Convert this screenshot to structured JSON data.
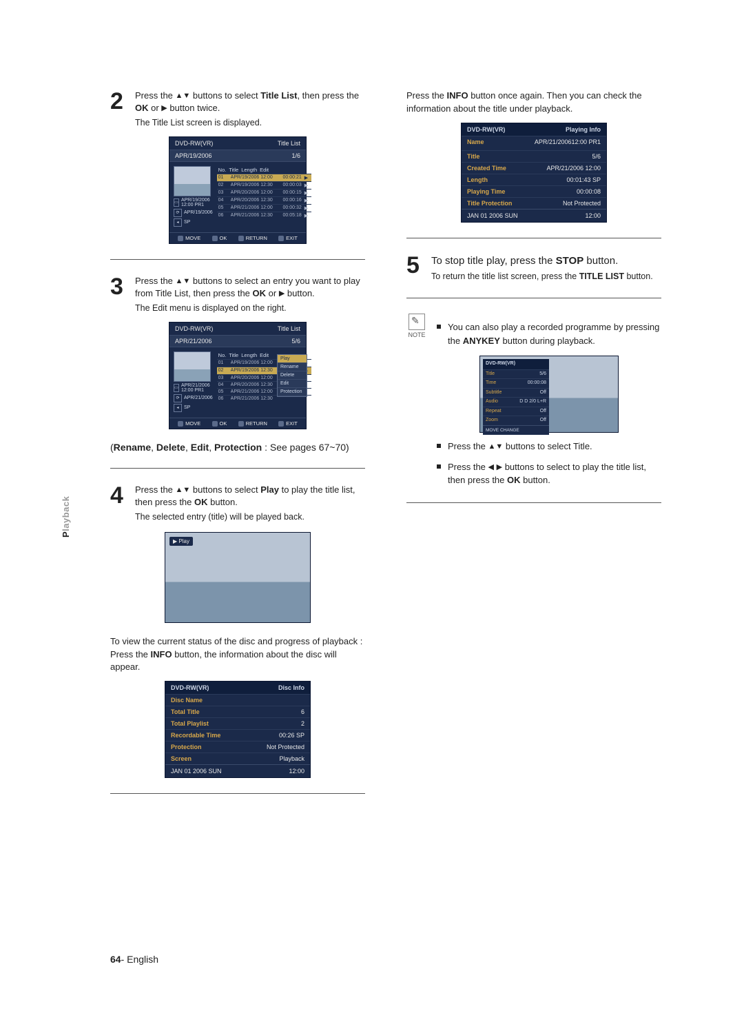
{
  "sideTab": {
    "bold": "P",
    "rest": "layback"
  },
  "pageNumber": "64",
  "pageLang": "English",
  "left": {
    "step2": {
      "num": "2",
      "l1_a": "Press the ",
      "l1_b": " buttons to select ",
      "l1_c": "Title List",
      "l1_d": ", then press the ",
      "l1_e": "OK",
      "l1_f": " or ",
      "l1_g": " button twice.",
      "sub": "The Title List screen is displayed."
    },
    "osd1": {
      "disc": "DVD-RW(VR)",
      "title": "Title List",
      "subA": "APR/19/2006",
      "subB": "1/6",
      "hdr": [
        "No.",
        "Title",
        "Length",
        "Edit"
      ],
      "rows": [
        {
          "n": "01",
          "t": "APR/19/2006 12:00",
          "l": "00:00:21",
          "sel": true
        },
        {
          "n": "02",
          "t": "APR/19/2006 12:30",
          "l": "00:00:03"
        },
        {
          "n": "03",
          "t": "APR/20/2006 12:00",
          "l": "00:00:15"
        },
        {
          "n": "04",
          "t": "APR/20/2006 12:30",
          "l": "00:00:16"
        },
        {
          "n": "05",
          "t": "APR/21/2006 12:00",
          "l": "00:00:32"
        },
        {
          "n": "06",
          "t": "APR/21/2006 12:30",
          "l": "00:05:18"
        }
      ],
      "side": {
        "a": "APR/19/2006 12:00 PR1",
        "b": "APR/19/2006",
        "c": "SP"
      },
      "ftr": [
        "MOVE",
        "OK",
        "RETURN",
        "EXIT"
      ]
    },
    "step3": {
      "num": "3",
      "l1_a": "Press the ",
      "l1_b": " buttons to select an entry you want to play from Title List, then press the ",
      "l1_c": "OK",
      "l1_d": " or ",
      "l1_e": " button.",
      "sub": "The Edit menu is displayed on the right."
    },
    "osd2": {
      "disc": "DVD-RW(VR)",
      "title": "Title List",
      "subA": "APR/21/2006",
      "subB": "5/6",
      "side": {
        "a": "APR/21/2006 12:00 PR1",
        "b": "APR/21/2006",
        "c": "SP"
      },
      "ctx": [
        "Play",
        "Rename",
        "Delete",
        "Edit",
        "Protection"
      ],
      "ftr": [
        "MOVE",
        "OK",
        "RETURN",
        "EXIT"
      ]
    },
    "paren": "(Rename, Delete, Edit, Protection : See pages 67~70)",
    "step4": {
      "num": "4",
      "l1_a": "Press the ",
      "l1_b": " buttons to select ",
      "l1_c": "Play",
      "l1_d": " to play the title list, then press the ",
      "l1_e": "OK",
      "l1_f": " button.",
      "sub": "The selected entry (title) will be played back."
    },
    "playLabel": "▶ Play",
    "viewInfo_a": "To view the current status of the disc and progress of playback : Press the ",
    "viewInfo_b": "INFO",
    "viewInfo_c": " button, the information about the disc will appear.",
    "discInfo": {
      "disc": "DVD-RW(VR)",
      "title": "Disc Info",
      "rows": [
        {
          "k": "Disc Name",
          "v": ""
        },
        {
          "k": "Total Title",
          "v": "6"
        },
        {
          "k": "Total Playlist",
          "v": "2"
        },
        {
          "k": "Recordable Time",
          "v": "00:26  SP"
        },
        {
          "k": "Protection",
          "v": "Not Protected"
        },
        {
          "k": "Screen",
          "v": "Playback"
        }
      ],
      "ftrA": "JAN 01 2006 SUN",
      "ftrB": "12:00"
    }
  },
  "right": {
    "intro_a": "Press the ",
    "intro_b": "INFO",
    "intro_c": " button once again. Then you can check the information about the title under playback.",
    "playInfo": {
      "disc": "DVD-RW(VR)",
      "title": "Playing Info",
      "nameK": "Name",
      "nameV": "APR/21/200612:00 PR1",
      "rows": [
        {
          "k": "Title",
          "v": "5/6"
        },
        {
          "k": "Created Time",
          "v": "APR/21/2006 12:00"
        },
        {
          "k": "Length",
          "v": "00:01:43 SP"
        },
        {
          "k": "Playing Time",
          "v": "00:00:08"
        },
        {
          "k": "Title Protection",
          "v": "Not Protected"
        }
      ],
      "ftrA": "JAN 01 2006 SUN",
      "ftrB": "12:00"
    },
    "step5": {
      "num": "5",
      "l1_a": "To stop title play, press the ",
      "l1_b": "STOP",
      "l1_c": " button.",
      "sub_a": "To return the title list screen, press the ",
      "sub_b": "TITLE LIST",
      "sub_c": " button."
    },
    "noteLabel": "NOTE",
    "note_a": "You can also play a recorded programme by pressing the ",
    "note_b": "ANYKEY",
    "note_c": " button during playback.",
    "anykey": {
      "disc": "DVD-RW(VR)",
      "rows": [
        {
          "k": "Title",
          "v": "5/6"
        },
        {
          "k": "Time",
          "v": "00:00:08"
        },
        {
          "k": "Subtitle",
          "v": "Off"
        },
        {
          "k": "Audio",
          "v": "D D 2/0 L+R"
        },
        {
          "k": "Repeat",
          "v": "Off"
        },
        {
          "k": "Zoom",
          "v": "Off"
        }
      ],
      "ftr": "MOVE    CHANGE"
    },
    "b1_a": "Press the ",
    "b1_b": " buttons to select Title.",
    "b2_a": "Press the ",
    "b2_b": " buttons to select to play the title list, then press the ",
    "b2_c": "OK",
    "b2_d": " button."
  }
}
